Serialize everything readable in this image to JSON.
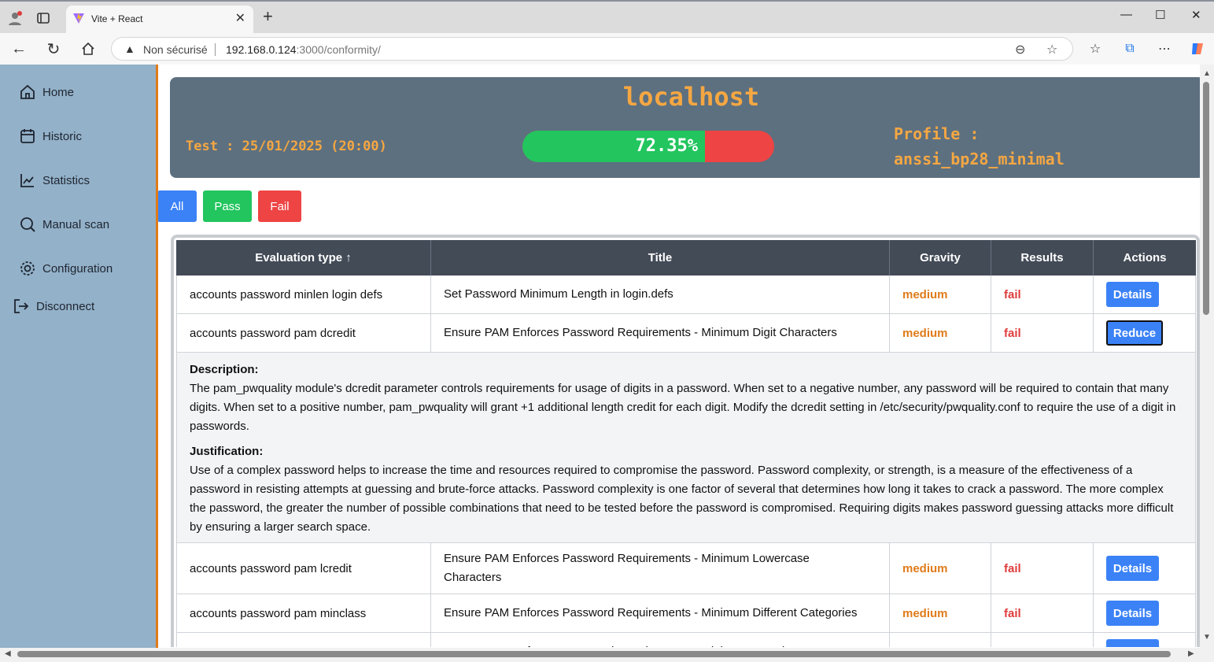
{
  "browser": {
    "tab_title": "Vite + React",
    "security_label": "Non sécurisé",
    "url_host": "192.168.0.124",
    "url_path": ":3000/conformity/"
  },
  "sidebar": {
    "items": [
      {
        "label": "Home",
        "icon": "home-icon"
      },
      {
        "label": "Historic",
        "icon": "calendar-icon"
      },
      {
        "label": "Statistics",
        "icon": "chart-icon"
      },
      {
        "label": "Manual scan",
        "icon": "search-icon"
      },
      {
        "label": "Configuration",
        "icon": "gear-icon"
      },
      {
        "label": "Disconnect",
        "icon": "logout-icon"
      }
    ]
  },
  "header": {
    "host": "localhost",
    "test_label": "Test : 25/01/2025 (20:00)",
    "score_text": "72.35%",
    "score_fraction": 0.7235,
    "profile_line1": "Profile :",
    "profile_line2": "anssi_bp28_minimal"
  },
  "filters": {
    "all": "All",
    "pass": "Pass",
    "fail": "Fail"
  },
  "colors": {
    "accent_orange": "#f5a742",
    "pass_green": "#22c55e",
    "fail_red": "#ee4444",
    "button_blue": "#3b82f6"
  },
  "table": {
    "headers": [
      "Evaluation type ↑",
      "Title",
      "Gravity",
      "Results",
      "Actions"
    ],
    "rows": [
      {
        "type": "accounts password minlen login defs",
        "title": "Set Password Minimum Length in login.defs",
        "gravity": "medium",
        "result": "fail",
        "action": "Details"
      },
      {
        "type": "accounts password pam dcredit",
        "title": "Ensure PAM Enforces Password Requirements - Minimum Digit Characters",
        "gravity": "medium",
        "result": "fail",
        "action": "Reduce"
      },
      {
        "type": "accounts password pam lcredit",
        "title": "Ensure PAM Enforces Password Requirements - Minimum Lowercase Characters",
        "gravity": "medium",
        "result": "fail",
        "action": "Details"
      },
      {
        "type": "accounts password pam minclass",
        "title": "Ensure PAM Enforces Password Requirements - Minimum Different Categories",
        "gravity": "medium",
        "result": "fail",
        "action": "Details"
      },
      {
        "type": "accounts password pam minlen",
        "title": "Ensure PAM Enforces Password Requirements - Minimum Length",
        "gravity": "medium",
        "result": "fail",
        "action": "Details"
      }
    ],
    "detail": {
      "description_label": "Description:",
      "description": "The pam_pwquality module's dcredit parameter controls requirements for usage of digits in a password. When set to a negative number, any password will be required to contain that many digits. When set to a positive number, pam_pwquality will grant +1 additional length credit for each digit. Modify the dcredit setting in /etc/security/pwquality.conf to require the use of a digit in passwords.",
      "justification_label": "Justification:",
      "justification": "Use of a complex password helps to increase the time and resources required to compromise the password. Password complexity, or strength, is a measure of the effectiveness of a password in resisting attempts at guessing and brute-force attacks. Password complexity is one factor of several that determines how long it takes to crack a password. The more complex the password, the greater the number of possible combinations that need to be tested before the password is compromised. Requiring digits makes password guessing attacks more difficult by ensuring a larger search space."
    }
  }
}
